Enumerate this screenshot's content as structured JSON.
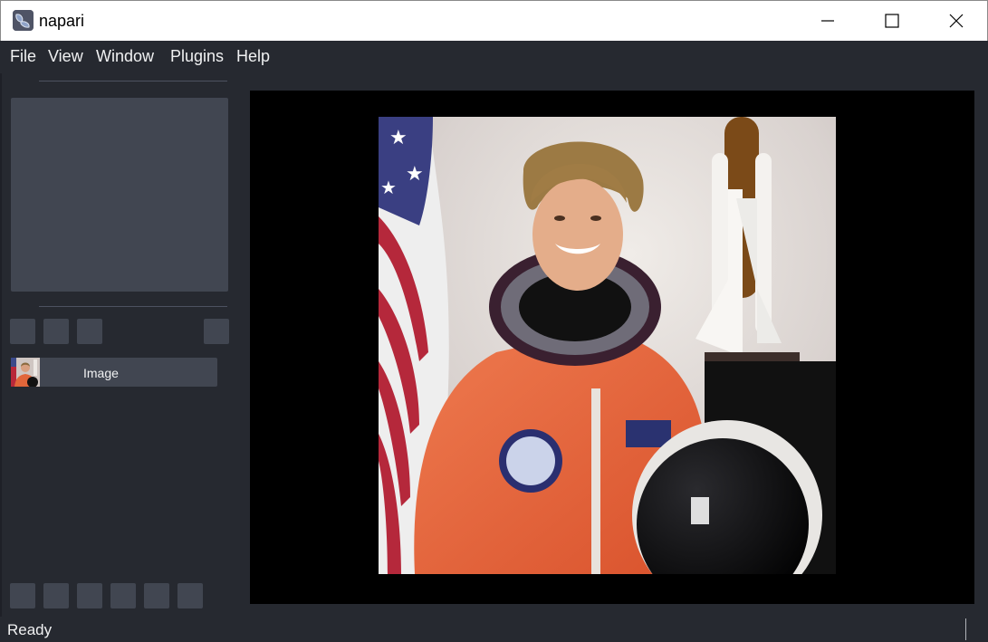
{
  "window": {
    "title": "napari",
    "icon": "napari-logo-icon",
    "controls": [
      "minimize-icon",
      "maximize-icon",
      "close-icon"
    ]
  },
  "menu": {
    "items": [
      {
        "label": "File"
      },
      {
        "label": "View"
      },
      {
        "label": "Window"
      },
      {
        "label": "Plugins"
      },
      {
        "label": "Help"
      }
    ]
  },
  "layers": {
    "list": [
      {
        "name": "Image",
        "thumbnail": "astronaut-thumbnail"
      }
    ]
  },
  "status": {
    "text": "Ready"
  },
  "colors": {
    "background": "#262930",
    "panel": "#414651",
    "text": "#f0f1f2",
    "canvas": "#000000"
  }
}
